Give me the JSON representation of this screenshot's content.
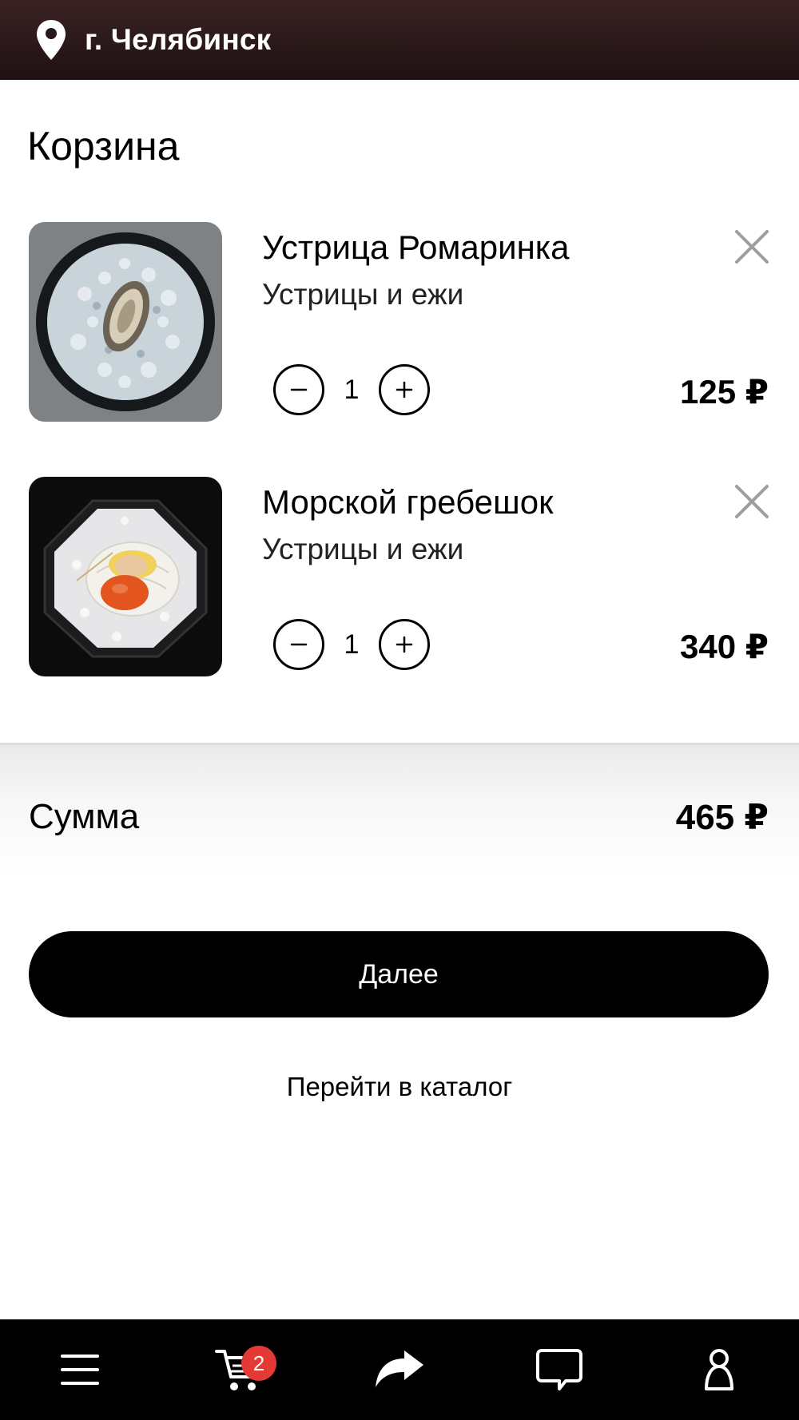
{
  "header": {
    "city": "г. Челябинск",
    "location_icon": "map-pin-icon"
  },
  "page": {
    "title": "Корзина"
  },
  "cart": {
    "items": [
      {
        "name": "Устрица Ромаринка",
        "category": "Устрицы и ежи",
        "quantity": "1",
        "price": "125 ₽"
      },
      {
        "name": "Морской гребешок",
        "category": "Устрицы и ежи",
        "quantity": "1",
        "price": "340 ₽"
      }
    ]
  },
  "summary": {
    "label": "Сумма",
    "total": "465 ₽"
  },
  "actions": {
    "next_label": "Далее",
    "catalog_label": "Перейти в каталог"
  },
  "tabbar": {
    "cart_badge": "2",
    "icons": [
      "menu-icon",
      "cart-icon",
      "share-icon",
      "chat-icon",
      "profile-icon"
    ]
  },
  "colors": {
    "header_bg": "#2a1718",
    "badge": "#e53935",
    "primary": "#000000"
  }
}
